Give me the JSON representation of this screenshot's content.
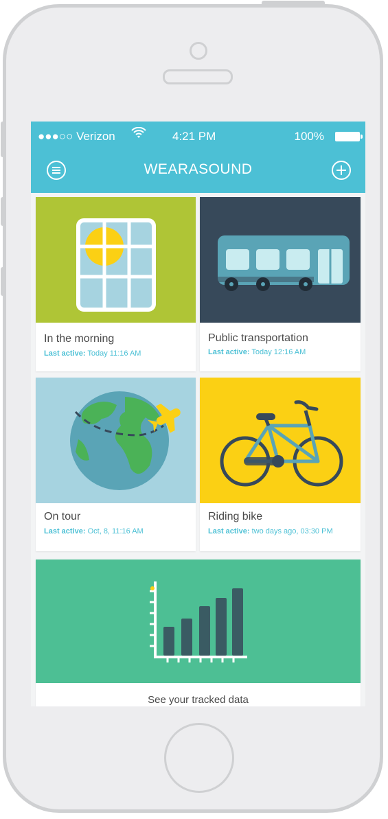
{
  "status_bar": {
    "carrier": "●●●○○ Verizon",
    "wifi_icon": "wifi-icon",
    "time": "4:21 PM",
    "battery": "100%",
    "battery_icon": "battery-full-icon"
  },
  "nav": {
    "title": "WEARASOUND",
    "menu_icon": "menu-icon",
    "add_icon": "add-icon"
  },
  "cards": [
    {
      "name": "In the morning",
      "last_active_label": "Last active:",
      "last_active_value": "Today 11:16 AM",
      "color": "#afc536"
    },
    {
      "name": "Public transportation",
      "last_active_label": "Last active:",
      "last_active_value": "Today 12:16 AM",
      "color": "#37495a"
    },
    {
      "name": "On tour",
      "last_active_label": "Last active:",
      "last_active_value": "Oct, 8, 11:16 AM",
      "color": "#a6d3e0"
    },
    {
      "name": "Riding bike",
      "last_active_label": "Last active:",
      "last_active_value": "two days ago, 03:30 PM",
      "color": "#fbd014"
    }
  ],
  "tracked": {
    "label": "See your tracked data",
    "color": "#4dbf94"
  },
  "colors": {
    "accent": "#4cc0d5",
    "meta_text": "#4cc0d5"
  }
}
